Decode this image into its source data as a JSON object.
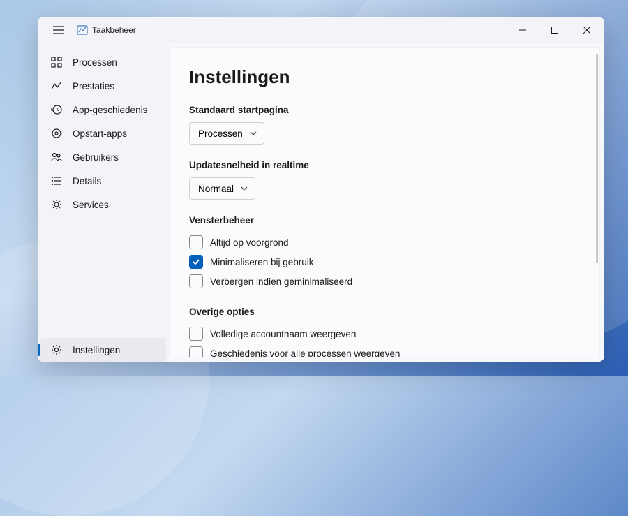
{
  "app": {
    "title": "Taakbeheer"
  },
  "sidebar": {
    "items": [
      {
        "label": "Processen"
      },
      {
        "label": "Prestaties"
      },
      {
        "label": "App-geschiedenis"
      },
      {
        "label": "Opstart-apps"
      },
      {
        "label": "Gebruikers"
      },
      {
        "label": "Details"
      },
      {
        "label": "Services"
      }
    ],
    "footer": {
      "label": "Instellingen"
    }
  },
  "content": {
    "heading": "Instellingen",
    "sections": {
      "defaultStart": {
        "label": "Standaard startpagina",
        "value": "Processen"
      },
      "updateSpeed": {
        "label": "Updatesnelheid in realtime",
        "value": "Normaal"
      },
      "windowMgmt": {
        "label": "Vensterbeheer",
        "options": [
          {
            "label": "Altijd op voorgrond",
            "checked": false
          },
          {
            "label": "Minimaliseren bij gebruik",
            "checked": true
          },
          {
            "label": "Verbergen indien geminimaliseerd",
            "checked": false
          }
        ]
      },
      "otherOptions": {
        "label": "Overige opties",
        "options": [
          {
            "label": "Volledige accountnaam weergeven",
            "checked": false
          },
          {
            "label": "Geschiedenis voor alle processen weergeven",
            "checked": false
          }
        ]
      }
    }
  }
}
